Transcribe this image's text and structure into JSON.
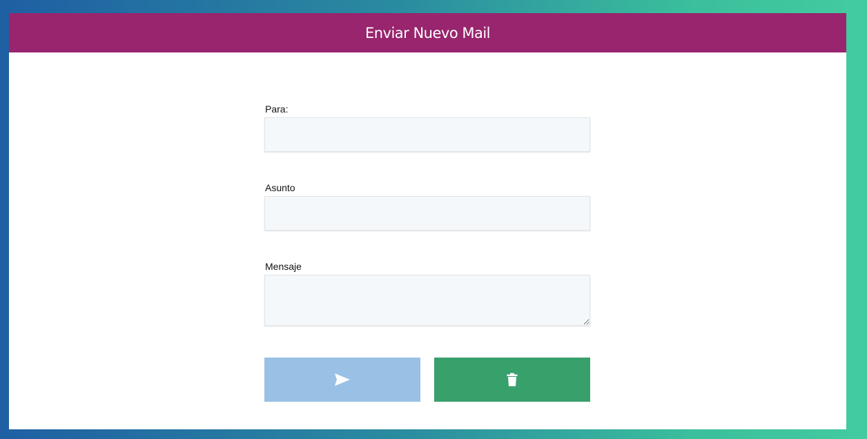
{
  "header": {
    "title": "Enviar Nuevo Mail"
  },
  "form": {
    "to": {
      "label": "Para:",
      "value": "",
      "placeholder": ""
    },
    "subject": {
      "label": "Asunto",
      "value": "",
      "placeholder": ""
    },
    "message": {
      "label": "Mensaje",
      "value": "",
      "placeholder": ""
    }
  },
  "buttons": {
    "send": {
      "icon": "send-icon",
      "color": "#99c1e6"
    },
    "delete": {
      "icon": "trash-icon",
      "color": "#38a06b"
    }
  },
  "colors": {
    "header": "#98256d",
    "background_gradient_start": "#1f5fa3",
    "background_gradient_end": "#43cba0"
  }
}
